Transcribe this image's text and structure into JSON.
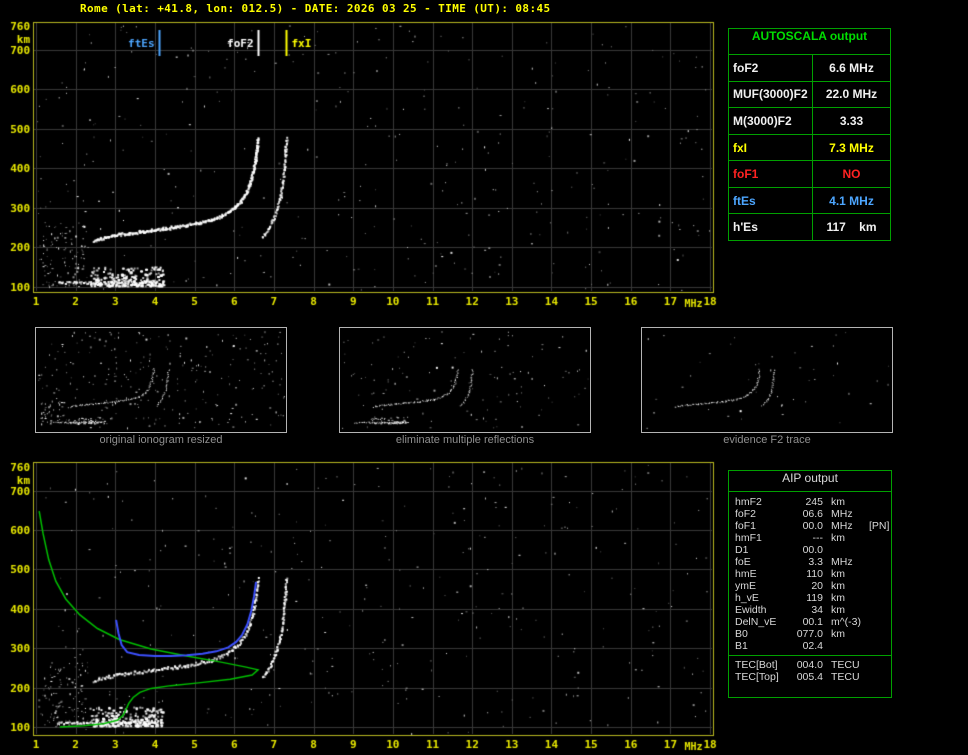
{
  "window_title": "Rome (lat: +41.8, lon: 012.5) - DATE: 2026 03 25 - TIME (UT): 08:45",
  "colors": {
    "background": "#000000",
    "title": "#ffff00",
    "axis": "#e8e800",
    "plot_border": "#b9b920",
    "grid": "#383838",
    "table_border": "#00a000",
    "autoscala_title": "#00dd00",
    "aip_text": "#d8d8d8",
    "caption": "#8f8f8f",
    "trace_white": "#ffffff",
    "profile_green": "#00c000",
    "fit_blue": "#3c50ff",
    "ftEs_blue": "#4da6ff",
    "foF1_red": "#ff2222",
    "fxI_yellow": "#ffff00"
  },
  "autoscala_table": {
    "title": "AUTOSCALA output",
    "rows": [
      {
        "param": "foF2",
        "value": "6.6 MHz",
        "color": "#f0f0f0"
      },
      {
        "param": "MUF(3000)F2",
        "value": "22.0 MHz",
        "color": "#f0f0f0"
      },
      {
        "param": "M(3000)F2",
        "value": "3.33",
        "color": "#f0f0f0"
      },
      {
        "param": "fxI",
        "value": "7.3 MHz",
        "color": "#ffff00"
      },
      {
        "param": "foF1",
        "value": "NO",
        "color": "#ff2222"
      },
      {
        "param": "ftEs",
        "value": "4.1 MHz",
        "color": "#4da6ff"
      },
      {
        "param": "h'Es",
        "value": "117    km",
        "color": "#f0f0f0"
      }
    ]
  },
  "thumbnails": [
    {
      "caption": "original ionogram resized"
    },
    {
      "caption": "eliminate multiple reflections"
    },
    {
      "caption": "evidence F2 trace"
    }
  ],
  "aip_table": {
    "title": "AIP output",
    "rows": [
      {
        "param": "hmF2",
        "value": "245",
        "unit": "km",
        "extra": ""
      },
      {
        "param": "foF2",
        "value": "06.6",
        "unit": "MHz",
        "extra": ""
      },
      {
        "param": "foF1",
        "value": "00.0",
        "unit": "MHz",
        "extra": "[PN]"
      },
      {
        "param": "hmF1",
        "value": "---",
        "unit": "km",
        "extra": ""
      },
      {
        "param": "D1",
        "value": "00.0",
        "unit": "",
        "extra": ""
      },
      {
        "param": "foE",
        "value": "3.3",
        "unit": "MHz",
        "extra": ""
      },
      {
        "param": "hmE",
        "value": "110",
        "unit": "km",
        "extra": ""
      },
      {
        "param": "ymE",
        "value": "20",
        "unit": "km",
        "extra": ""
      },
      {
        "param": "h_vE",
        "value": "119",
        "unit": "km",
        "extra": ""
      },
      {
        "param": "Ewidth",
        "value": "34",
        "unit": "km",
        "extra": ""
      },
      {
        "param": "DelN_vE",
        "value": "00.1",
        "unit": "m^(-3)",
        "extra": ""
      },
      {
        "param": "B0",
        "value": "077.0",
        "unit": "km",
        "extra": ""
      },
      {
        "param": "B1",
        "value": "02.4",
        "unit": "",
        "extra": ""
      }
    ],
    "tec_rows": [
      {
        "param": "TEC[Bot]",
        "value": "004.0",
        "unit": "TECU"
      },
      {
        "param": "TEC[Top]",
        "value": "005.4",
        "unit": "TECU"
      }
    ]
  },
  "chart_data": {
    "type": "scatter",
    "xlabel": "MHz",
    "ylabel": "km",
    "xlim": [
      1,
      18
    ],
    "ylim": [
      100,
      760
    ],
    "xticks": [
      1,
      2,
      3,
      4,
      5,
      6,
      7,
      8,
      9,
      10,
      11,
      12,
      13,
      14,
      15,
      16,
      17,
      18
    ],
    "yticks": [
      760,
      700,
      600,
      500,
      400,
      300,
      200,
      100
    ],
    "grid": true,
    "plots": [
      {
        "id": "autoscala_ionogram",
        "markers": [
          {
            "label": "ftEs",
            "freq_mhz": 4.1,
            "color": "#4da6ff"
          },
          {
            "label": "foF2",
            "freq_mhz": 6.6,
            "color": "#ffffff"
          },
          {
            "label": "fxI",
            "freq_mhz": 7.3,
            "color": "#ffff00"
          }
        ],
        "series": [
          "f2_trace_o_mode",
          "f2_trace_x_mode",
          "es_layer"
        ]
      },
      {
        "id": "aip_profile_ionogram",
        "markers": [],
        "series": [
          "f2_trace_o_mode",
          "f2_trace_x_mode",
          "es_layer",
          "electron_density_profile",
          "autoscala_restored_trace"
        ]
      }
    ],
    "series": {
      "f2_trace_o_mode": {
        "color": "#ffffff",
        "units": [
          "MHz",
          "km"
        ],
        "points": [
          [
            2.45,
            218
          ],
          [
            2.6,
            224
          ],
          [
            2.8,
            229
          ],
          [
            3.0,
            233
          ],
          [
            3.3,
            237
          ],
          [
            3.6,
            241
          ],
          [
            3.9,
            245
          ],
          [
            4.2,
            249
          ],
          [
            4.5,
            253
          ],
          [
            4.8,
            258
          ],
          [
            5.1,
            264
          ],
          [
            5.4,
            271
          ],
          [
            5.65,
            280
          ],
          [
            5.85,
            291
          ],
          [
            6.0,
            303
          ],
          [
            6.15,
            318
          ],
          [
            6.28,
            338
          ],
          [
            6.38,
            362
          ],
          [
            6.46,
            392
          ],
          [
            6.52,
            425
          ],
          [
            6.56,
            455
          ],
          [
            6.58,
            478
          ]
        ]
      },
      "f2_trace_x_mode": {
        "color": "#e8e8e8",
        "units": [
          "MHz",
          "km"
        ],
        "points": [
          [
            6.7,
            228
          ],
          [
            6.85,
            248
          ],
          [
            6.97,
            272
          ],
          [
            7.07,
            300
          ],
          [
            7.15,
            332
          ],
          [
            7.21,
            368
          ],
          [
            7.25,
            405
          ],
          [
            7.28,
            445
          ],
          [
            7.3,
            478
          ]
        ]
      },
      "es_layer": {
        "color": "#ffffff",
        "units": [
          "MHz",
          "km"
        ],
        "points": [
          [
            1.55,
            112
          ],
          [
            2.0,
            113
          ],
          [
            2.5,
            112
          ],
          [
            3.0,
            114
          ],
          [
            3.5,
            113
          ],
          [
            4.05,
            115
          ]
        ],
        "cluster": {
          "f": [
            2.35,
            4.2
          ],
          "h": [
            104,
            152
          ]
        }
      },
      "electron_density_profile": {
        "color": "#00c000",
        "units": [
          "MHz",
          "km"
        ],
        "points": [
          [
            1.08,
            648
          ],
          [
            1.18,
            590
          ],
          [
            1.32,
            525
          ],
          [
            1.5,
            470
          ],
          [
            1.75,
            425
          ],
          [
            2.1,
            385
          ],
          [
            2.55,
            350
          ],
          [
            3.1,
            322
          ],
          [
            3.9,
            298
          ],
          [
            4.8,
            280
          ],
          [
            5.7,
            264
          ],
          [
            6.3,
            252
          ],
          [
            6.6,
            245
          ],
          [
            6.45,
            232
          ],
          [
            5.9,
            221
          ],
          [
            5.1,
            212
          ],
          [
            4.4,
            205
          ],
          [
            3.9,
            198
          ],
          [
            3.62,
            188
          ],
          [
            3.45,
            175
          ],
          [
            3.34,
            160
          ],
          [
            3.27,
            145
          ],
          [
            3.2,
            130
          ],
          [
            3.05,
            117
          ],
          [
            2.7,
            108
          ],
          [
            2.2,
            103
          ],
          [
            1.6,
            100
          ]
        ]
      },
      "autoscala_restored_trace": {
        "color": "#3c50ff",
        "units": [
          "MHz",
          "km"
        ],
        "points": [
          [
            3.02,
            372
          ],
          [
            3.08,
            338
          ],
          [
            3.16,
            308
          ],
          [
            3.3,
            290
          ],
          [
            3.6,
            283
          ],
          [
            4.0,
            280
          ],
          [
            4.4,
            280
          ],
          [
            4.8,
            282
          ],
          [
            5.2,
            286
          ],
          [
            5.55,
            292
          ],
          [
            5.85,
            302
          ],
          [
            6.05,
            316
          ],
          [
            6.2,
            334
          ],
          [
            6.33,
            360
          ],
          [
            6.43,
            395
          ],
          [
            6.5,
            432
          ],
          [
            6.55,
            468
          ]
        ]
      }
    }
  }
}
